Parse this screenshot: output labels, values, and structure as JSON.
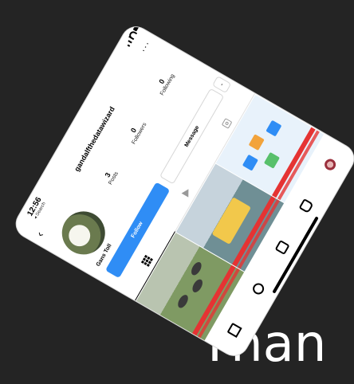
{
  "slide": {
    "text": "Than"
  },
  "status_bar": {
    "time": "12:56",
    "back_link": "◂ Search"
  },
  "profile": {
    "username": "gandalfthedatawizard",
    "display_name": "Gans Toll",
    "stats": [
      {
        "value": "3",
        "label": "Posts"
      },
      {
        "value": "0",
        "label": "Followers"
      },
      {
        "value": "0",
        "label": "Following"
      }
    ],
    "follow_label": "Follow",
    "message_label": "Message"
  },
  "icons": {
    "back": "chevron-left-icon",
    "more": "more-options-icon",
    "grid": "grid-icon",
    "reels": "reels-icon",
    "tagged": "tagged-icon"
  },
  "nav": [
    "home-icon",
    "search-icon",
    "reels-icon",
    "shop-icon",
    "profile-icon"
  ]
}
